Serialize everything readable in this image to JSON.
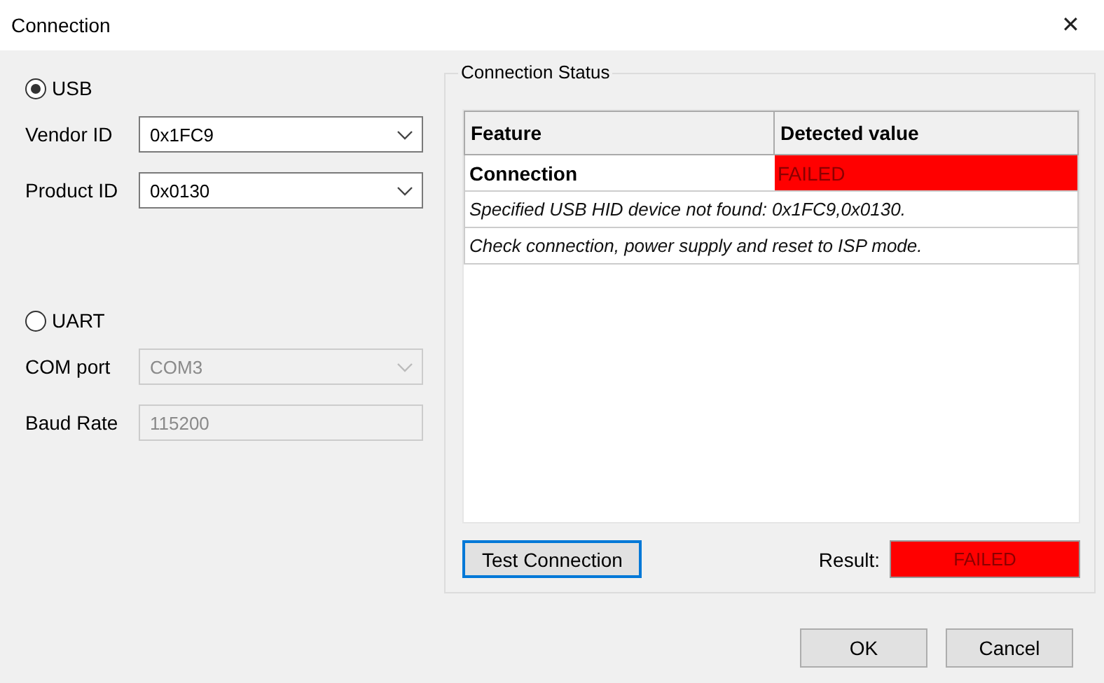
{
  "window": {
    "title": "Connection",
    "close": "✕"
  },
  "interfaces": [
    {
      "label": "USB",
      "selected": true,
      "fields": [
        {
          "label": "Vendor ID",
          "kind": "combo",
          "value": "0x1FC9",
          "disabled": false
        },
        {
          "label": "Product ID",
          "kind": "combo",
          "value": "0x0130",
          "disabled": false
        }
      ]
    },
    {
      "label": "UART",
      "selected": false,
      "fields": [
        {
          "label": "COM port",
          "kind": "combo",
          "value": "COM3",
          "disabled": true
        },
        {
          "label": "Baud Rate",
          "kind": "text",
          "value": "115200",
          "disabled": true
        }
      ]
    }
  ],
  "status": {
    "title": "Connection Status",
    "table": {
      "columns": [
        "Feature",
        "Detected value"
      ],
      "rows": [
        {
          "kind": "pair",
          "feature": "Connection",
          "value": "FAILED",
          "color": "#ff0000"
        },
        {
          "kind": "message",
          "text": "Specified USB HID device not found: 0x1FC9,0x0130."
        },
        {
          "kind": "message",
          "text": "Check connection, power supply and reset to ISP mode."
        }
      ]
    },
    "test_button": {
      "label": "Test Connection",
      "focused": true
    },
    "result": {
      "label": "Result:",
      "value": "FAILED",
      "color": "#ff0000"
    }
  },
  "buttons": [
    "OK",
    "Cancel"
  ]
}
